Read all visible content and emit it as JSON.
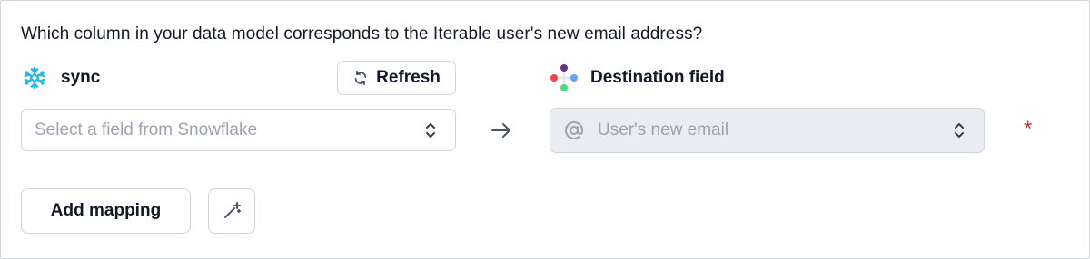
{
  "question": "Which column in your data model corresponds to the Iterable user's new email address?",
  "source": {
    "name": "sync",
    "icon": "snowflake-icon",
    "refresh_label": "Refresh",
    "select_placeholder": "Select a field from Snowflake"
  },
  "destination": {
    "title": "Destination field",
    "icon": "iterable-icon",
    "field_placeholder": "User's new email",
    "required_marker": "*"
  },
  "actions": {
    "add_mapping_label": "Add mapping",
    "magic_icon": "magic-wand-icon"
  },
  "colors": {
    "snowflake": "#29b5e8",
    "required": "#c0392b",
    "disabled_bg": "#e9ecf0"
  }
}
